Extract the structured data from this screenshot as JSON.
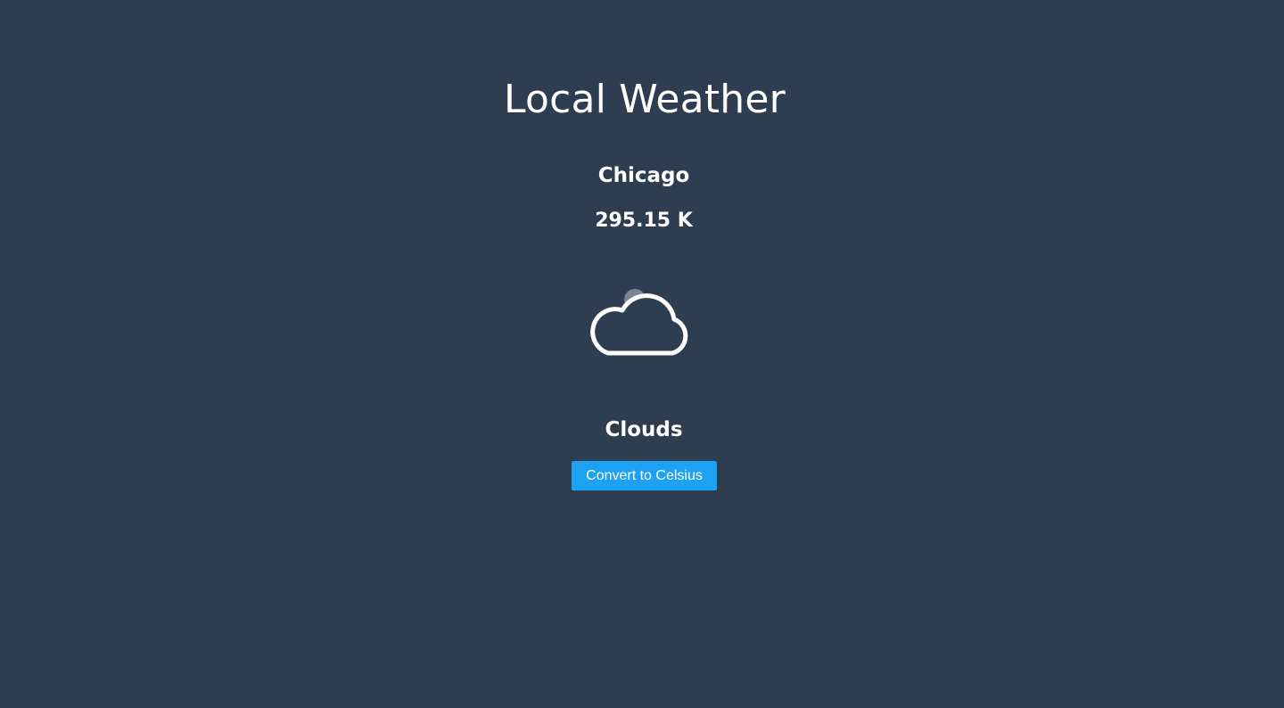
{
  "header": {
    "title": "Local Weather"
  },
  "weather": {
    "city": "Chicago",
    "temperature": "295.15 K",
    "condition": "Clouds",
    "icon": "cloud-icon"
  },
  "actions": {
    "convert_label": "Convert to Celsius"
  },
  "colors": {
    "background": "#2e3d50",
    "button": "#1da1f2",
    "text": "#ffffff"
  }
}
